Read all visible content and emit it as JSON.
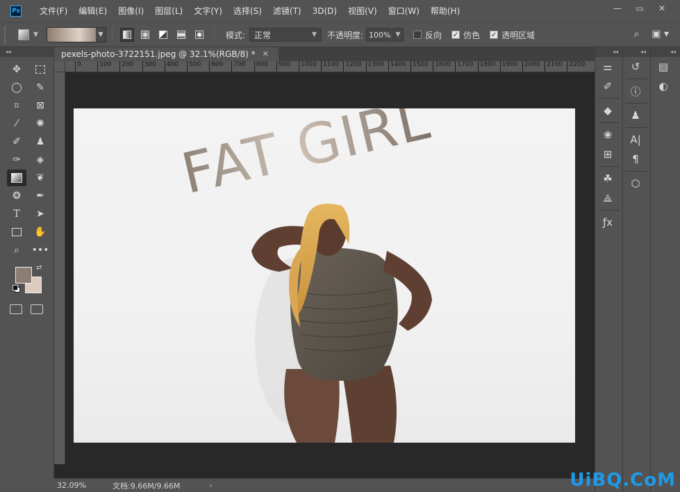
{
  "menubar": {
    "logo": "Ps",
    "items": [
      "文件(F)",
      "编辑(E)",
      "图像(I)",
      "图层(L)",
      "文字(Y)",
      "选择(S)",
      "滤镜(T)",
      "3D(D)",
      "视图(V)",
      "窗口(W)",
      "帮助(H)"
    ],
    "window_controls": [
      "minimize",
      "restore",
      "close"
    ]
  },
  "options": {
    "mode_label": "模式:",
    "mode_value": "正常",
    "opacity_label": "不透明度:",
    "opacity_value": "100%",
    "reverse_label": "反向",
    "dither_label": "仿色",
    "transparency_label": "透明区域",
    "reverse_checked": false,
    "dither_checked": true,
    "transparency_checked": true
  },
  "document": {
    "tab_title": "pexels-photo-3722151.jpeg @ 32.1%(RGB/8) *",
    "ruler_ticks": [
      "0",
      "100",
      "200",
      "300",
      "400",
      "500",
      "600",
      "700",
      "800",
      "900",
      "1000",
      "1100",
      "1200",
      "1300",
      "1400",
      "1500",
      "1600",
      "1700",
      "1800",
      "1900",
      "2000",
      "2100",
      "2200"
    ],
    "overlay_text": "FAT GIRL"
  },
  "colors": {
    "foreground": "#8c7d72",
    "background": "#dccbc0",
    "accent_blue": "#31a8ff"
  },
  "status": {
    "zoom": "32.09%",
    "doc_info": "文档:9.66M/9.66M"
  },
  "watermark": "UiBQ.CoM"
}
